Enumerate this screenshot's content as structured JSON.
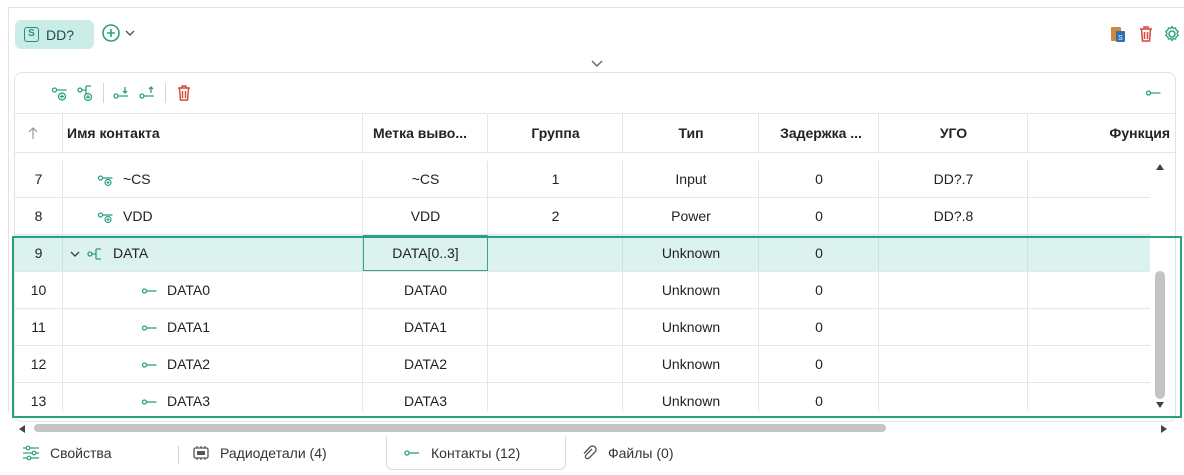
{
  "component": {
    "badge": "S",
    "designator": "DD?"
  },
  "toolbar_icons": [
    "pin-add-icon",
    "pin-group-add-icon",
    "pin-move-down-icon",
    "pin-move-up-icon",
    "delete-icon",
    "pin-view-icon"
  ],
  "table": {
    "columns": [
      "Имя контакта",
      "Метка выво...",
      "Группа",
      "Тип",
      "Задержка ...",
      "УГО",
      "Функция"
    ],
    "rows": [
      {
        "num": "7",
        "name": "~CS",
        "mark": "~CS",
        "group": "1",
        "type": "Input",
        "delay": "0",
        "ugo": "DD?.7",
        "kind": "pin"
      },
      {
        "num": "8",
        "name": "VDD",
        "mark": "VDD",
        "group": "2",
        "type": "Power",
        "delay": "0",
        "ugo": "DD?.8",
        "kind": "pin"
      },
      {
        "num": "9",
        "name": "DATA",
        "mark": "DATA[0..3]",
        "group": "",
        "type": "Unknown",
        "delay": "0",
        "ugo": "",
        "kind": "bus",
        "expanded": true,
        "selected": true
      },
      {
        "num": "10",
        "name": "DATA0",
        "mark": "DATA0",
        "group": "",
        "type": "Unknown",
        "delay": "0",
        "ugo": "",
        "kind": "subpin"
      },
      {
        "num": "11",
        "name": "DATA1",
        "mark": "DATA1",
        "group": "",
        "type": "Unknown",
        "delay": "0",
        "ugo": "",
        "kind": "subpin"
      },
      {
        "num": "12",
        "name": "DATA2",
        "mark": "DATA2",
        "group": "",
        "type": "Unknown",
        "delay": "0",
        "ugo": "",
        "kind": "subpin"
      },
      {
        "num": "13",
        "name": "DATA3",
        "mark": "DATA3",
        "group": "",
        "type": "Unknown",
        "delay": "0",
        "ugo": "",
        "kind": "subpin"
      }
    ]
  },
  "tabs": [
    {
      "label": "Свойства",
      "icon": "properties-icon"
    },
    {
      "label": "Радиодетали (4)",
      "icon": "chip-icon"
    },
    {
      "label": "Контакты (12)",
      "icon": "pin-icon",
      "active": true
    },
    {
      "label": "Файлы (0)",
      "icon": "paperclip-icon"
    }
  ],
  "colors": {
    "accent": "#2aa082",
    "selection": "#dcf2ef",
    "delete": "#d9433b"
  }
}
